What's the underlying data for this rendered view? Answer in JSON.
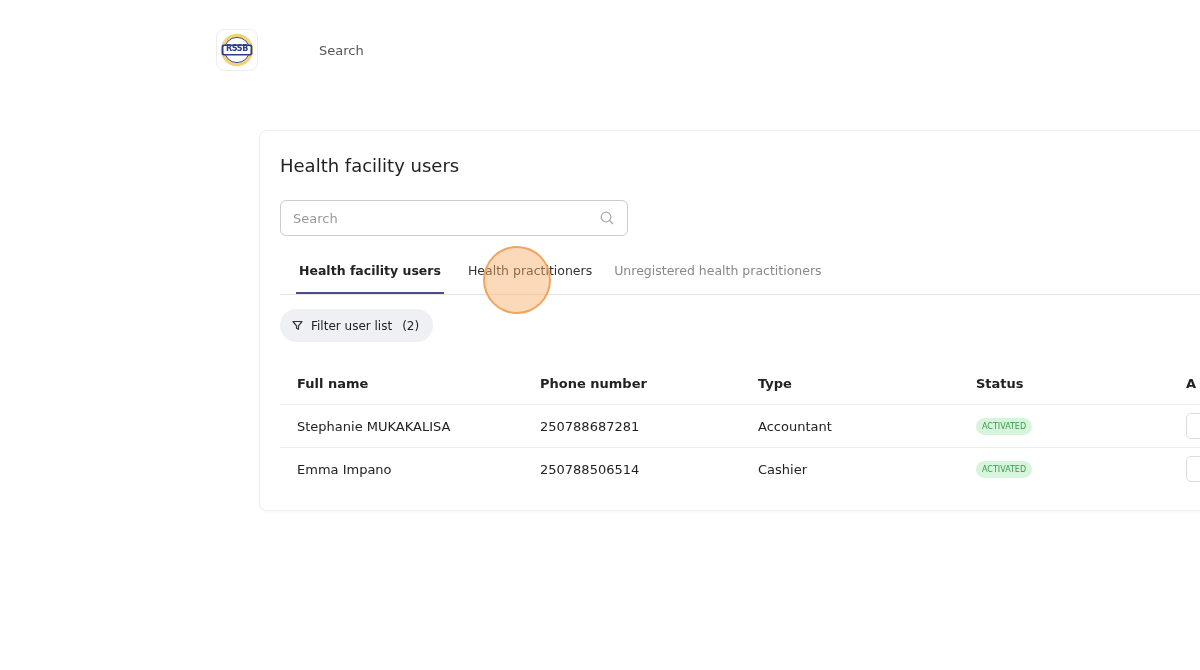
{
  "header": {
    "logo_text": "RSSB",
    "search_label": "Search"
  },
  "card": {
    "title": "Health facility users",
    "search": {
      "placeholder": "Search"
    },
    "tabs": [
      {
        "label": "Health facility users",
        "selected": true
      },
      {
        "label": "Health practitioners",
        "selected": false
      },
      {
        "label": "Unregistered health practitioners",
        "selected": false
      }
    ],
    "filter": {
      "label": "Filter user list",
      "count": "(2)"
    },
    "table": {
      "columns": [
        "Full name",
        "Phone number",
        "Type",
        "Status",
        "A"
      ],
      "rows": [
        {
          "full_name": "Stephanie MUKAKALISA",
          "phone": "250788687281",
          "type": "Accountant",
          "status": "ACTIVATED"
        },
        {
          "full_name": "Emma Impano",
          "phone": "250788506514",
          "type": "Cashier",
          "status": "ACTIVATED"
        }
      ]
    }
  }
}
